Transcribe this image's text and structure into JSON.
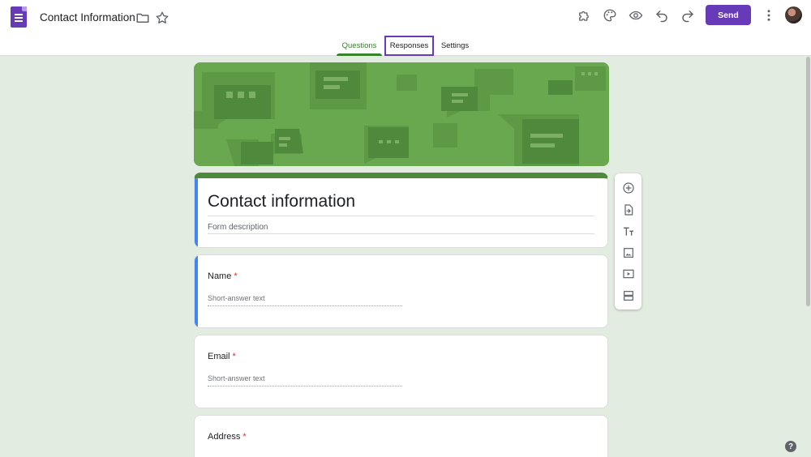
{
  "header": {
    "app_icon": "google-forms-icon",
    "doc_title": "Contact Information",
    "folder_icon": "folder-icon",
    "star_icon": "star-icon",
    "addons_icon": "puzzle-icon",
    "theme_icon": "palette-icon",
    "preview_icon": "eye-icon",
    "undo_icon": "undo-icon",
    "redo_icon": "redo-icon",
    "send_label": "Send",
    "more_icon": "more-vert-icon",
    "accent": "#673ab7"
  },
  "tabs": [
    {
      "label": "Questions",
      "active": true
    },
    {
      "label": "Responses",
      "active": false
    },
    {
      "label": "Settings",
      "active": false
    }
  ],
  "form": {
    "title": "Contact information",
    "description_placeholder": "Form description",
    "theme_color": "#4f8a3c",
    "background_color": "#e3ece1"
  },
  "questions": [
    {
      "label": "Name",
      "required_mark": "*",
      "answer_placeholder": "Short-answer text"
    },
    {
      "label": "Email",
      "required_mark": "*",
      "answer_placeholder": "Short-answer text"
    },
    {
      "label": "Address",
      "required_mark": "*"
    }
  ],
  "toolbar": {
    "items": [
      "add-question-icon",
      "import-questions-icon",
      "add-title-icon",
      "add-image-icon",
      "add-video-icon",
      "add-section-icon"
    ]
  },
  "help_label": "?"
}
